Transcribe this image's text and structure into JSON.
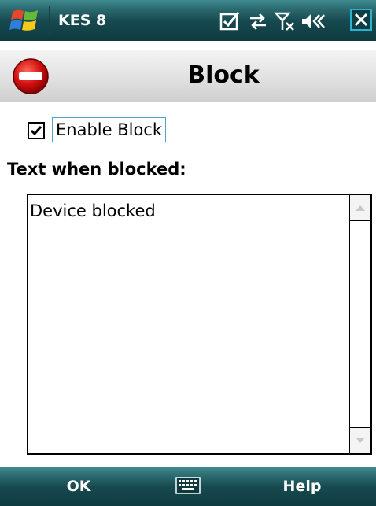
{
  "titlebar": {
    "app_title": "KES 8",
    "icons": [
      "windows-start-icon",
      "tasks-check-icon",
      "connectivity-icon",
      "signal-off-icon",
      "volume-icon",
      "close-icon"
    ]
  },
  "header": {
    "title": "Block",
    "icon": "block-icon"
  },
  "form": {
    "enable_checkbox_label": "Enable Block",
    "enable_checked": true,
    "text_label": "Text when blocked:",
    "text_value": "Device blocked"
  },
  "menubar": {
    "left_softkey": "OK",
    "right_softkey": "Help",
    "keyboard_icon": "keyboard-icon"
  },
  "colors": {
    "bar_gradient_top": "#3f8a8f",
    "bar_gradient_bottom": "#0e3a40",
    "close_border": "#2bb2d0",
    "block_red": "#d01010",
    "focus_border": "#4aa6c6"
  }
}
